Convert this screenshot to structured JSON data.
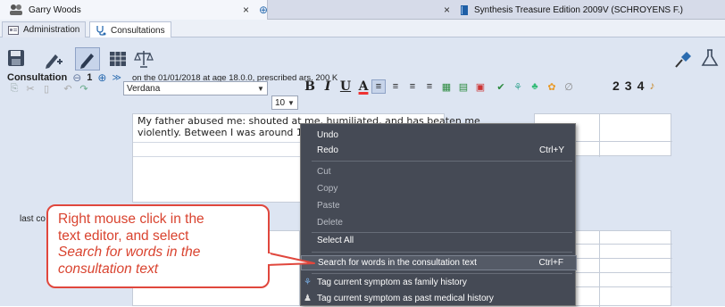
{
  "window_tabs": {
    "patient_tab": "Garry Woods",
    "book_tab": "Synthesis Treasure Edition 2009V (SCHROYENS F.)",
    "close_symbol": "×",
    "add_symbol": "⊕"
  },
  "sub_tabs": [
    "Administration",
    "Consultations"
  ],
  "consultation": {
    "label": "Consultation",
    "number": "1",
    "info": "on the 01/01/2018 at age 18.0.0, prescribed ars. 200 K"
  },
  "toolbar": {
    "font_name": "Verdana",
    "font_size": "10",
    "bold": "B",
    "italic": "I",
    "underline": "U",
    "font_color": "A",
    "numbers": [
      "2",
      "3",
      "4"
    ]
  },
  "editor": {
    "text": "My father abused me: shouted at me, humiliated, and has beaten me violently. Between I was around 1",
    "line1": "My father abused me: shouted at me, humiliated, and has beaten me",
    "line2": "violently. Between I was around 1"
  },
  "last_consultations_label": "last co",
  "context_menu": {
    "items": [
      {
        "label": "Undo",
        "shortcut": "",
        "enabled": true
      },
      {
        "label": "Redo",
        "shortcut": "Ctrl+Y",
        "enabled": true
      },
      {
        "label": "Cut",
        "shortcut": "",
        "enabled": false
      },
      {
        "label": "Copy",
        "shortcut": "",
        "enabled": false
      },
      {
        "label": "Paste",
        "shortcut": "",
        "enabled": false
      },
      {
        "label": "Delete",
        "shortcut": "",
        "enabled": false
      },
      {
        "label": "Select All",
        "shortcut": "",
        "enabled": true
      },
      {
        "label": "Search for words in the consultation text",
        "shortcut": "Ctrl+F",
        "enabled": true,
        "highlighted": true
      },
      {
        "label": "Tag current symptom as family history",
        "shortcut": "",
        "enabled": true
      },
      {
        "label": "Tag current symptom as past medical history",
        "shortcut": "",
        "enabled": true
      }
    ]
  },
  "callout": {
    "line1": "Right mouse click in the",
    "line2": "text editor, and select",
    "line3_italic": "Search for words in the",
    "line4_italic": "consultation text"
  },
  "colors": {
    "callout_red": "#e0473d",
    "menu_bg": "#454a55",
    "panel_bg": "#dde5f2"
  }
}
